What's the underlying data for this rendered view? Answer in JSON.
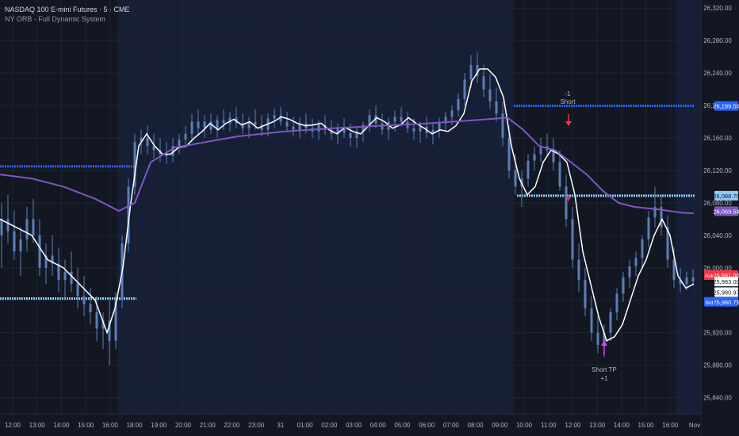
{
  "header": {
    "symbol_title": "NASDAQ 100 E-mini Futures · 5 · CME",
    "indicator_name": "NY ORB - Full Dynamic System"
  },
  "price_axis": {
    "ticks": [
      "26,320.00",
      "26,280.00",
      "26,240.00",
      "26,200.00",
      "26,160.00",
      "26,120.00",
      "26,080.00",
      "26,040.00",
      "26,000.00",
      "25,960.00",
      "25,920.00",
      "25,880.00",
      "25,840.00"
    ],
    "tick_values": [
      26320,
      26280,
      26240,
      26200,
      26160,
      26120,
      26080,
      26040,
      26000,
      25960,
      25920,
      25880,
      25840
    ],
    "labels": [
      {
        "text": "26,199.50",
        "price": 26199.5,
        "color": "#2962ff",
        "text_color": "#ffffff"
      },
      {
        "text": "26,088.75",
        "price": 26088.75,
        "color": "#90caf9",
        "text_color": "#131722"
      },
      {
        "text": "26,069.59",
        "price": 26069.59,
        "color": "#7e57c2",
        "text_color": "#ffffff"
      },
      {
        "text": "25,991.00",
        "price": 25991.0,
        "color": "#f23645",
        "text_color": "#ffffff",
        "tag": "Ask"
      },
      {
        "text": "25,983.00",
        "price": 25983.0,
        "color": "#ffffff",
        "text_color": "#131722"
      },
      {
        "text": "25,980.97",
        "price": 25970.0,
        "color": "#ffffff",
        "text_color": "#131722"
      },
      {
        "text": "25,980.75",
        "price": 25958.0,
        "color": "#2962ff",
        "text_color": "#ffffff",
        "tag": "Bid"
      }
    ]
  },
  "time_axis": {
    "labels": [
      "12:00",
      "13:00",
      "14:00",
      "15:00",
      "16:00",
      "18:00",
      "19:00",
      "20:00",
      "21:00",
      "22:00",
      "23:00",
      "31",
      "01:00",
      "02:00",
      "03:00",
      "04:00",
      "05:00",
      "06:00",
      "07:00",
      "08:00",
      "09:00",
      "10:00",
      "11:00",
      "12:00",
      "13:00",
      "14:00",
      "15:00",
      "16:00",
      "Nov"
    ]
  },
  "annotations": {
    "short_label": "Short",
    "short_qty": "-1",
    "tp_label": "Short TP",
    "tp_qty": "+1"
  },
  "colors": {
    "background": "#131722",
    "session_shade": "#1a2745",
    "candle": "#5b7fb8",
    "fast_ma": "#ffffff",
    "slow_ma": "#7e57c2",
    "orb_high": "#2962ff",
    "orb_low": "#90caf9",
    "short_arrow": "#f23645",
    "tp_arrow": "#e040fb"
  },
  "chart_data": {
    "type": "line",
    "y_axis_range": [
      25820,
      26330
    ],
    "series": [
      {
        "name": "",
        "points": [
          [
            0,
            26060
          ],
          [
            20,
            26050
          ],
          [
            40,
            26040
          ],
          [
            60,
            26010
          ],
          [
            80,
            26000
          ],
          [
            100,
            25980
          ],
          [
            120,
            25960
          ],
          [
            135,
            25920
          ],
          [
            145,
            25950
          ],
          [
            155,
            26000
          ],
          [
            165,
            26080
          ],
          [
            175,
            26150
          ],
          [
            185,
            26165
          ],
          [
            195,
            26150
          ],
          [
            205,
            26140
          ],
          [
            215,
            26140
          ],
          [
            225,
            26148
          ],
          [
            235,
            26150
          ],
          [
            245,
            26160
          ],
          [
            255,
            26168
          ],
          [
            265,
            26178
          ],
          [
            275,
            26170
          ],
          [
            285,
            26178
          ],
          [
            295,
            26183
          ],
          [
            305,
            26176
          ],
          [
            315,
            26180
          ],
          [
            325,
            26172
          ],
          [
            335,
            26176
          ],
          [
            345,
            26180
          ],
          [
            355,
            26186
          ],
          [
            365,
            26183
          ],
          [
            375,
            26178
          ],
          [
            385,
            26175
          ],
          [
            395,
            26176
          ],
          [
            405,
            26178
          ],
          [
            415,
            26170
          ],
          [
            425,
            26165
          ],
          [
            435,
            26173
          ],
          [
            445,
            26168
          ],
          [
            455,
            26165
          ],
          [
            465,
            26175
          ],
          [
            475,
            26185
          ],
          [
            485,
            26180
          ],
          [
            495,
            26172
          ],
          [
            505,
            26176
          ],
          [
            515,
            26185
          ],
          [
            525,
            26178
          ],
          [
            535,
            26172
          ],
          [
            545,
            26165
          ],
          [
            555,
            26170
          ],
          [
            565,
            26168
          ],
          [
            575,
            26175
          ],
          [
            585,
            26190
          ],
          [
            595,
            26230
          ],
          [
            605,
            26245
          ],
          [
            615,
            26245
          ],
          [
            625,
            26235
          ],
          [
            635,
            26210
          ],
          [
            645,
            26150
          ],
          [
            655,
            26110
          ],
          [
            665,
            26090
          ],
          [
            675,
            26100
          ],
          [
            685,
            26130
          ],
          [
            695,
            26145
          ],
          [
            705,
            26140
          ],
          [
            715,
            26130
          ],
          [
            725,
            26090
          ],
          [
            735,
            26020
          ],
          [
            745,
            25980
          ],
          [
            755,
            25940
          ],
          [
            765,
            25910
          ],
          [
            775,
            25915
          ],
          [
            785,
            25930
          ],
          [
            795,
            25960
          ],
          [
            805,
            25990
          ],
          [
            815,
            26010
          ],
          [
            825,
            26040
          ],
          [
            835,
            26060
          ],
          [
            845,
            26040
          ],
          [
            855,
            25990
          ],
          [
            865,
            25975
          ],
          [
            875,
            25980
          ]
        ]
      },
      {
        "name": "",
        "points": [
          [
            0,
            26115
          ],
          [
            40,
            26110
          ],
          [
            80,
            26100
          ],
          [
            120,
            26085
          ],
          [
            150,
            26070
          ],
          [
            170,
            26080
          ],
          [
            190,
            26130
          ],
          [
            220,
            26148
          ],
          [
            260,
            26155
          ],
          [
            300,
            26162
          ],
          [
            360,
            26168
          ],
          [
            420,
            26172
          ],
          [
            480,
            26175
          ],
          [
            540,
            26178
          ],
          [
            600,
            26182
          ],
          [
            640,
            26185
          ],
          [
            660,
            26170
          ],
          [
            680,
            26150
          ],
          [
            700,
            26145
          ],
          [
            720,
            26130
          ],
          [
            740,
            26115
          ],
          [
            760,
            26095
          ],
          [
            780,
            26080
          ],
          [
            800,
            26075
          ],
          [
            830,
            26072
          ],
          [
            860,
            26068
          ],
          [
            875,
            26067
          ]
        ]
      }
    ],
    "candles": [
      [
        0,
        26040,
        26080,
        26000,
        26060
      ],
      [
        8,
        26060,
        26090,
        26030,
        26045
      ],
      [
        16,
        26045,
        26070,
        26010,
        26020
      ],
      [
        24,
        26020,
        26050,
        25990,
        26035
      ],
      [
        32,
        26035,
        26075,
        26020,
        26060
      ],
      [
        40,
        26060,
        26085,
        26030,
        26040
      ],
      [
        48,
        26040,
        26060,
        25990,
        26000
      ],
      [
        56,
        26000,
        26030,
        25980,
        26015
      ],
      [
        64,
        26015,
        26040,
        25990,
        26005
      ],
      [
        72,
        26005,
        26025,
        25970,
        25985
      ],
      [
        80,
        25985,
        26010,
        25960,
        25995
      ],
      [
        88,
        25995,
        26020,
        25970,
        25980
      ],
      [
        96,
        25980,
        26000,
        25950,
        25965
      ],
      [
        104,
        25965,
        25990,
        25940,
        25955
      ],
      [
        112,
        25955,
        25975,
        25930,
        25945
      ],
      [
        120,
        25945,
        25965,
        25910,
        25925
      ],
      [
        128,
        25925,
        25945,
        25900,
        25935
      ],
      [
        136,
        25935,
        25960,
        25880,
        25910
      ],
      [
        144,
        25910,
        25970,
        25900,
        25960
      ],
      [
        152,
        25960,
        26040,
        25950,
        26030
      ],
      [
        160,
        26030,
        26110,
        26020,
        26100
      ],
      [
        168,
        26100,
        26165,
        26090,
        26155
      ],
      [
        176,
        26155,
        26170,
        26140,
        26160
      ],
      [
        184,
        26160,
        26175,
        26140,
        26150
      ],
      [
        192,
        26150,
        26165,
        26135,
        26145
      ],
      [
        200,
        26145,
        26160,
        26130,
        26140
      ],
      [
        208,
        26140,
        26155,
        26128,
        26138
      ],
      [
        216,
        26138,
        26160,
        26130,
        26150
      ],
      [
        224,
        26150,
        26165,
        26140,
        26158
      ],
      [
        232,
        26158,
        26175,
        26148,
        26165
      ],
      [
        240,
        26165,
        26190,
        26155,
        26180
      ],
      [
        248,
        26180,
        26195,
        26165,
        26172
      ],
      [
        256,
        26172,
        26188,
        26160,
        26180
      ],
      [
        264,
        26180,
        26190,
        26165,
        26170
      ],
      [
        272,
        26170,
        26188,
        26160,
        26182
      ],
      [
        280,
        26182,
        26195,
        26170,
        26178
      ],
      [
        288,
        26178,
        26192,
        26168,
        26185
      ],
      [
        296,
        26185,
        26198,
        26172,
        26178
      ],
      [
        304,
        26178,
        26190,
        26165,
        26172
      ],
      [
        312,
        26172,
        26186,
        26160,
        26180
      ],
      [
        320,
        26180,
        26195,
        26170,
        26176
      ],
      [
        328,
        26176,
        26188,
        26162,
        26170
      ],
      [
        336,
        26170,
        26190,
        26162,
        26184
      ],
      [
        344,
        26184,
        26196,
        26172,
        26188
      ],
      [
        352,
        26188,
        26198,
        26175,
        26180
      ],
      [
        360,
        26180,
        26192,
        26168,
        26174
      ],
      [
        368,
        26174,
        26186,
        26162,
        26170
      ],
      [
        376,
        26170,
        26185,
        26160,
        26178
      ],
      [
        384,
        26178,
        26190,
        26166,
        26172
      ],
      [
        392,
        26172,
        26184,
        26160,
        26168
      ],
      [
        400,
        26168,
        26182,
        26158,
        26176
      ],
      [
        408,
        26176,
        26188,
        26164,
        26170
      ],
      [
        416,
        26170,
        26182,
        26158,
        26165
      ],
      [
        424,
        26165,
        26178,
        26152,
        26172
      ],
      [
        432,
        26172,
        26184,
        26160,
        26166
      ],
      [
        440,
        26166,
        26178,
        26150,
        26160
      ],
      [
        448,
        26160,
        26174,
        26148,
        26168
      ],
      [
        456,
        26168,
        26180,
        26155,
        26176
      ],
      [
        464,
        26176,
        26195,
        26168,
        26188
      ],
      [
        472,
        26188,
        26200,
        26172,
        26178
      ],
      [
        480,
        26178,
        26190,
        26164,
        26170
      ],
      [
        488,
        26170,
        26185,
        26158,
        26180
      ],
      [
        496,
        26180,
        26194,
        26168,
        26186
      ],
      [
        504,
        26186,
        26198,
        26174,
        26180
      ],
      [
        512,
        26180,
        26192,
        26166,
        26172
      ],
      [
        520,
        26172,
        26184,
        26158,
        26168
      ],
      [
        528,
        26168,
        26180,
        26154,
        26174
      ],
      [
        536,
        26174,
        26186,
        26160,
        26166
      ],
      [
        544,
        26166,
        26178,
        26152,
        26170
      ],
      [
        552,
        26170,
        26185,
        26160,
        26178
      ],
      [
        560,
        26178,
        26192,
        26168,
        26186
      ],
      [
        568,
        26186,
        26200,
        26176,
        26194
      ],
      [
        576,
        26194,
        26215,
        26186,
        26208
      ],
      [
        584,
        26208,
        26240,
        26200,
        26232
      ],
      [
        592,
        26232,
        26262,
        26222,
        26250
      ],
      [
        600,
        26250,
        26265,
        26228,
        26236
      ],
      [
        608,
        26236,
        26250,
        26210,
        26220
      ],
      [
        616,
        26220,
        26238,
        26196,
        26205
      ],
      [
        624,
        26205,
        26222,
        26180,
        26190
      ],
      [
        632,
        26190,
        26205,
        26150,
        26160
      ],
      [
        640,
        26160,
        26175,
        26110,
        26120
      ],
      [
        648,
        26120,
        26140,
        26090,
        26100
      ],
      [
        656,
        26100,
        26120,
        26075,
        26110
      ],
      [
        664,
        26110,
        26140,
        26100,
        26132
      ],
      [
        672,
        26132,
        26150,
        26120,
        26140
      ],
      [
        680,
        26140,
        26160,
        26130,
        26150
      ],
      [
        688,
        26150,
        26165,
        26138,
        26145
      ],
      [
        696,
        26145,
        26160,
        26120,
        26130
      ],
      [
        704,
        26130,
        26145,
        26095,
        26100
      ],
      [
        712,
        26100,
        26115,
        26050,
        26060
      ],
      [
        720,
        26060,
        26075,
        26000,
        26010
      ],
      [
        728,
        26010,
        26030,
        25970,
        25985
      ],
      [
        736,
        25985,
        26000,
        25940,
        25950
      ],
      [
        744,
        25950,
        25965,
        25910,
        25920
      ],
      [
        752,
        25920,
        25940,
        25895,
        25905
      ],
      [
        760,
        25905,
        25930,
        25890,
        25920
      ],
      [
        768,
        25920,
        25950,
        25910,
        25945
      ],
      [
        776,
        25945,
        25975,
        25935,
        25968
      ],
      [
        784,
        25968,
        25995,
        25958,
        25988
      ],
      [
        792,
        25988,
        26010,
        25975,
        26002
      ],
      [
        800,
        26002,
        26020,
        25990,
        26012
      ],
      [
        808,
        26012,
        26040,
        26000,
        26035
      ],
      [
        816,
        26035,
        26070,
        26025,
        26062
      ],
      [
        824,
        26062,
        26100,
        26050,
        26075
      ],
      [
        832,
        26075,
        26090,
        26040,
        26050
      ],
      [
        840,
        26050,
        26065,
        26000,
        26010
      ],
      [
        848,
        26010,
        26025,
        25975,
        25985
      ],
      [
        856,
        25985,
        26000,
        25970,
        25980
      ],
      [
        864,
        25980,
        25995,
        25972,
        25988
      ],
      [
        872,
        25988,
        25998,
        25978,
        25983
      ]
    ]
  }
}
